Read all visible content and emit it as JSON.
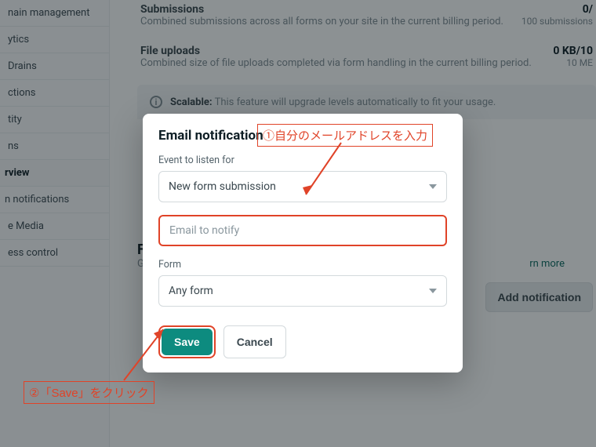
{
  "sidebar": {
    "items": [
      {
        "label": "nain management"
      },
      {
        "label": "ytics"
      },
      {
        "label": "Drains"
      },
      {
        "label": "ctions"
      },
      {
        "label": "tity"
      },
      {
        "label": "ns"
      },
      {
        "label": "rview",
        "active": true
      },
      {
        "label": "n notifications"
      },
      {
        "label": "e Media"
      },
      {
        "label": "ess control"
      }
    ]
  },
  "usage": {
    "submissions": {
      "title": "Submissions",
      "desc": "Combined submissions across all forms on your site in the current billing period.",
      "value": "0/",
      "sub": "100 submissions"
    },
    "uploads": {
      "title": "File uploads",
      "desc": "Combined size of file uploads completed via form handling in the current billing period.",
      "value": "0 KB/10",
      "sub": "10 ME"
    }
  },
  "banner": {
    "strong": "Scalable:",
    "rest": "This feature will upgrade levels automatically to fit your usage."
  },
  "form_section": {
    "title_first_letter": "F",
    "subtitle_prefix": "G",
    "learn_more": "rn more"
  },
  "add_button": "Add notification",
  "modal": {
    "title": "Email notification",
    "event_label": "Event to listen for",
    "event_value": "New form submission",
    "email_placeholder": "Email to notify",
    "form_label": "Form",
    "form_value": "Any form",
    "save": "Save",
    "cancel": "Cancel"
  },
  "callout1": "①自分のメールアドレスを入力",
  "callout2": "②「Save」をクリック"
}
